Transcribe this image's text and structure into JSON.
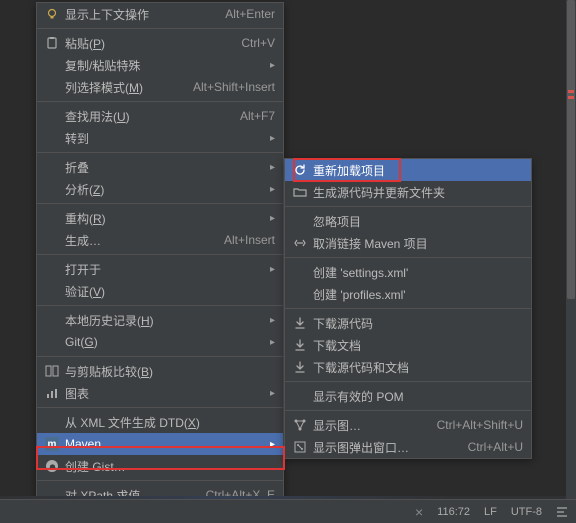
{
  "menu1": {
    "items": [
      {
        "kind": "item",
        "icon": "bulb-icon",
        "label": "显示上下文操作",
        "shortcut": "Alt+Enter"
      },
      {
        "kind": "sep"
      },
      {
        "kind": "item",
        "icon": "paste-icon",
        "label": "粘贴(P)",
        "underline": "P",
        "shortcut": "Ctrl+V"
      },
      {
        "kind": "item",
        "icon": "",
        "label": "复制/粘贴特殊",
        "submenu": true
      },
      {
        "kind": "item",
        "icon": "",
        "label": "列选择模式(M)",
        "underline": "M",
        "shortcut": "Alt+Shift+Insert"
      },
      {
        "kind": "sep"
      },
      {
        "kind": "item",
        "icon": "",
        "label": "查找用法(U)",
        "underline": "U",
        "shortcut": "Alt+F7"
      },
      {
        "kind": "item",
        "icon": "",
        "label": "转到",
        "submenu": true
      },
      {
        "kind": "sep"
      },
      {
        "kind": "item",
        "icon": "",
        "label": "折叠",
        "submenu": true
      },
      {
        "kind": "item",
        "icon": "",
        "label": "分析(Z)",
        "underline": "Z",
        "submenu": true
      },
      {
        "kind": "sep"
      },
      {
        "kind": "item",
        "icon": "",
        "label": "重构(R)",
        "underline": "R",
        "submenu": true
      },
      {
        "kind": "item",
        "icon": "",
        "label": "生成…",
        "shortcut": "Alt+Insert"
      },
      {
        "kind": "sep"
      },
      {
        "kind": "item",
        "icon": "",
        "label": "打开于",
        "submenu": true
      },
      {
        "kind": "item",
        "icon": "",
        "label": "验证(V)",
        "underline": "V"
      },
      {
        "kind": "sep"
      },
      {
        "kind": "item",
        "icon": "",
        "label": "本地历史记录(H)",
        "underline": "H",
        "submenu": true
      },
      {
        "kind": "item",
        "icon": "",
        "label": "Git(G)",
        "underline": "G",
        "submenu": true
      },
      {
        "kind": "sep"
      },
      {
        "kind": "item",
        "icon": "diff-icon",
        "label": "与剪贴板比较(B)",
        "underline": "B"
      },
      {
        "kind": "item",
        "icon": "chart-icon",
        "label": "图表",
        "submenu": true
      },
      {
        "kind": "sep"
      },
      {
        "kind": "item",
        "icon": "",
        "label": "从 XML 文件生成 DTD(X)",
        "underline": "X"
      },
      {
        "kind": "item",
        "icon": "maven-icon",
        "label": "Maven",
        "submenu": true,
        "highlighted": true
      },
      {
        "kind": "item",
        "icon": "github-icon",
        "label": "创建 Gist…"
      },
      {
        "kind": "sep"
      },
      {
        "kind": "item",
        "icon": "",
        "label": "对 XPath 求值…",
        "shortcut": "Ctrl+Alt+X, E"
      }
    ]
  },
  "menu2": {
    "items": [
      {
        "kind": "item",
        "icon": "reload-icon",
        "label": "重新加载项目",
        "highlighted": true
      },
      {
        "kind": "item",
        "icon": "folder-icon",
        "label": "生成源代码并更新文件夹"
      },
      {
        "kind": "sep"
      },
      {
        "kind": "item",
        "icon": "",
        "label": "忽略项目"
      },
      {
        "kind": "item",
        "icon": "unlink-icon",
        "label": "取消链接 Maven 项目"
      },
      {
        "kind": "sep"
      },
      {
        "kind": "item",
        "icon": "",
        "label": "创建 'settings.xml'"
      },
      {
        "kind": "item",
        "icon": "",
        "label": "创建 'profiles.xml'"
      },
      {
        "kind": "sep"
      },
      {
        "kind": "item",
        "icon": "download-icon",
        "label": "下载源代码"
      },
      {
        "kind": "item",
        "icon": "download-icon",
        "label": "下载文档"
      },
      {
        "kind": "item",
        "icon": "download-icon",
        "label": "下载源代码和文档"
      },
      {
        "kind": "sep"
      },
      {
        "kind": "item",
        "icon": "",
        "label": "显示有效的 POM"
      },
      {
        "kind": "sep"
      },
      {
        "kind": "item",
        "icon": "graph-icon",
        "label": "显示图…",
        "shortcut": "Ctrl+Alt+Shift+U"
      },
      {
        "kind": "item",
        "icon": "graph-popup-icon",
        "label": "显示图弹出窗口…",
        "shortcut": "Ctrl+Alt+U"
      }
    ]
  },
  "statusbar": {
    "close": "×",
    "position": "116:72",
    "line_ending": "LF",
    "encoding": "UTF-8"
  }
}
